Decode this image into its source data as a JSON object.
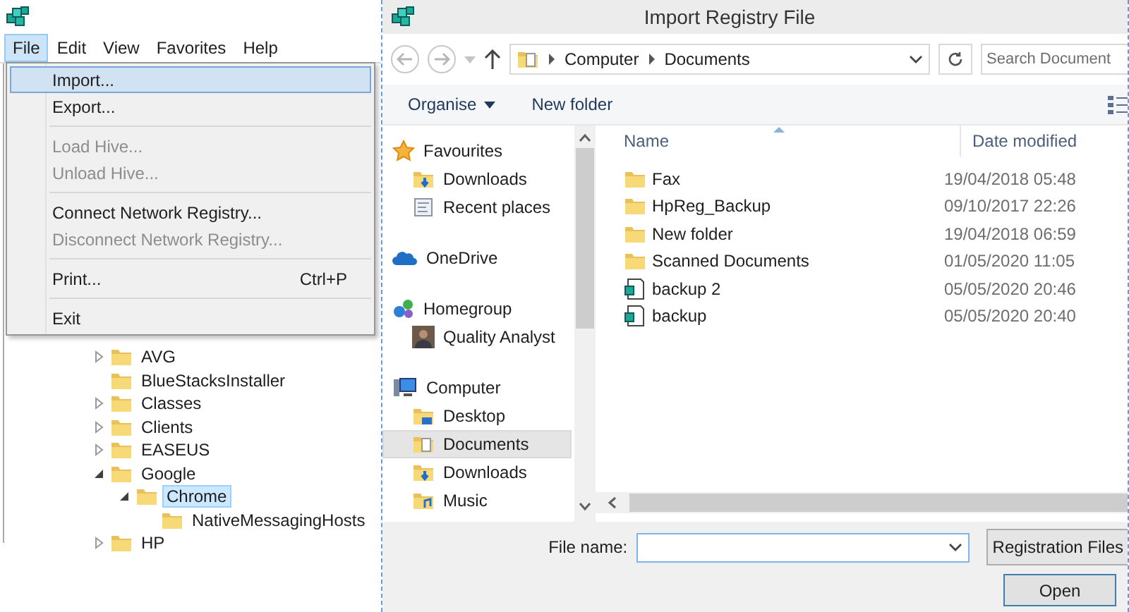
{
  "registry_editor": {
    "menu_bar": [
      {
        "label": "File",
        "selected": true
      },
      {
        "label": "Edit",
        "selected": false
      },
      {
        "label": "View",
        "selected": false
      },
      {
        "label": "Favorites",
        "selected": false
      },
      {
        "label": "Help",
        "selected": false
      }
    ],
    "file_menu": [
      {
        "kind": "item",
        "label": "Import...",
        "selected": true,
        "disabled": false
      },
      {
        "kind": "item",
        "label": "Export...",
        "selected": false,
        "disabled": false
      },
      {
        "kind": "separator"
      },
      {
        "kind": "item",
        "label": "Load Hive...",
        "selected": false,
        "disabled": true
      },
      {
        "kind": "item",
        "label": "Unload Hive...",
        "selected": false,
        "disabled": true
      },
      {
        "kind": "separator"
      },
      {
        "kind": "item",
        "label": "Connect Network Registry...",
        "selected": false,
        "disabled": false
      },
      {
        "kind": "item",
        "label": "Disconnect Network Registry...",
        "selected": false,
        "disabled": true
      },
      {
        "kind": "separator"
      },
      {
        "kind": "item",
        "label": "Print...",
        "shortcut": "Ctrl+P",
        "selected": false,
        "disabled": false
      },
      {
        "kind": "separator"
      },
      {
        "kind": "item",
        "label": "Exit",
        "selected": false,
        "disabled": false
      }
    ],
    "tree": [
      {
        "label": "AVG",
        "expanded": false,
        "selected": false
      },
      {
        "label": "BlueStacksInstaller",
        "selected": false
      },
      {
        "label": "Classes",
        "expanded": false,
        "selected": false
      },
      {
        "label": "Clients",
        "expanded": false,
        "selected": false
      },
      {
        "label": "EASEUS",
        "expanded": false,
        "selected": false
      },
      {
        "label": "Google",
        "expanded": true,
        "selected": false,
        "children": [
          {
            "label": "Chrome",
            "expanded": true,
            "selected": true,
            "children": [
              {
                "label": "NativeMessagingHosts",
                "selected": false
              }
            ]
          }
        ]
      },
      {
        "label": "HP",
        "expanded": false,
        "selected": false
      }
    ]
  },
  "dialog": {
    "title": "Import Registry File",
    "address": [
      "Computer",
      "Documents"
    ],
    "search": {
      "placeholder": "Search Document"
    },
    "toolbar": [
      "Organise",
      "New folder"
    ],
    "navigation": [
      {
        "label": "Favourites",
        "kind": "star",
        "selected": false,
        "children": [
          {
            "label": "Downloads",
            "kind": "downloads",
            "selected": false
          },
          {
            "label": "Recent places",
            "kind": "recent",
            "selected": false
          }
        ]
      },
      {
        "label": "OneDrive",
        "kind": "cloud",
        "selected": false
      },
      {
        "label": "Homegroup",
        "kind": "homegroup",
        "selected": false,
        "children": [
          {
            "label": "Quality Analyst",
            "kind": "person",
            "selected": false
          }
        ]
      },
      {
        "label": "Computer",
        "kind": "computer",
        "selected": false,
        "children": [
          {
            "label": "Desktop",
            "kind": "desktop",
            "selected": false
          },
          {
            "label": "Documents",
            "kind": "documents",
            "selected": true
          },
          {
            "label": "Downloads",
            "kind": "downloads",
            "selected": false
          },
          {
            "label": "Music",
            "kind": "music",
            "selected": false
          }
        ]
      }
    ],
    "columns": [
      "Name",
      "Date modified"
    ],
    "files": [
      {
        "name": "Fax",
        "date": "19/04/2018 05:48",
        "kind": "folder"
      },
      {
        "name": "HpReg_Backup",
        "date": "09/10/2017 22:26",
        "kind": "folder"
      },
      {
        "name": "New folder",
        "date": "19/04/2018 06:59",
        "kind": "folder"
      },
      {
        "name": "Scanned Documents",
        "date": "01/05/2020 11:05",
        "kind": "folder"
      },
      {
        "name": "backup 2",
        "date": "05/05/2020 20:46",
        "kind": "registration"
      },
      {
        "name": "backup",
        "date": "05/05/2020 20:40",
        "kind": "registration"
      }
    ],
    "file_name": {
      "label": "File name:"
    },
    "file_type": "Registration Files",
    "buttons": [
      "Open"
    ]
  }
}
